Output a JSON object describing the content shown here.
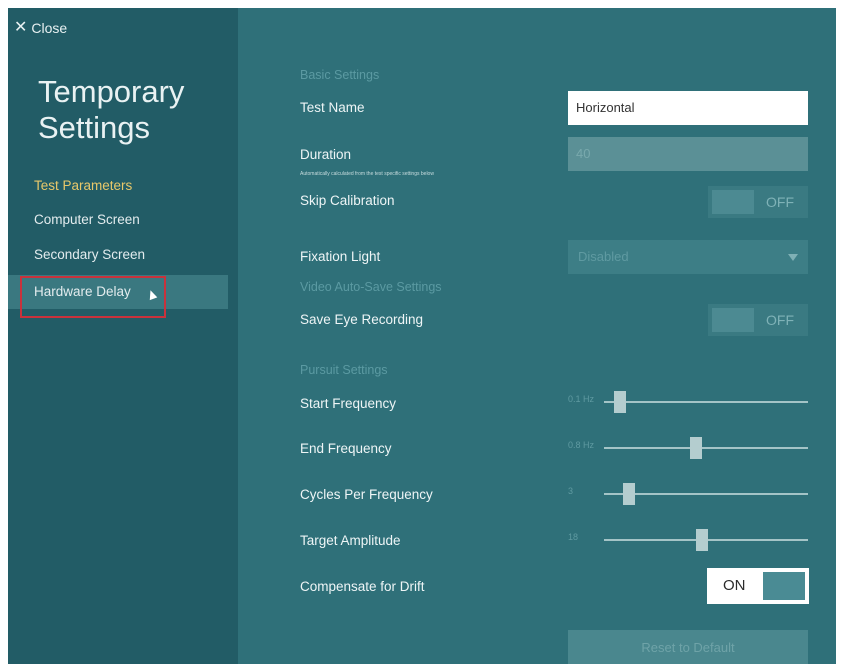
{
  "sidebar": {
    "close_label": "Close",
    "title_line1": "Temporary",
    "title_line2": "Settings",
    "items": [
      {
        "label": "Test Parameters"
      },
      {
        "label": "Computer Screen"
      },
      {
        "label": "Secondary Screen"
      },
      {
        "label": "Hardware Delay"
      }
    ]
  },
  "basic": {
    "section": "Basic Settings",
    "test_name_label": "Test Name",
    "test_name_value": "Horizontal",
    "duration_label": "Duration",
    "duration_note": "Automatically calculated from the test specific settings below",
    "duration_value": "40",
    "skip_calibration_label": "Skip Calibration",
    "skip_calibration_state": "OFF",
    "fixation_light_label": "Fixation Light",
    "fixation_light_value": "Disabled"
  },
  "video": {
    "section": "Video Auto-Save Settings",
    "save_eye_label": "Save Eye Recording",
    "save_eye_state": "OFF"
  },
  "pursuit": {
    "section": "Pursuit Settings",
    "sliders": [
      {
        "label": "Start Frequency",
        "value": "0.1 Hz",
        "fraction": 0.05
      },
      {
        "label": "End Frequency",
        "value": "0.8 Hz",
        "fraction": 0.45
      },
      {
        "label": "Cycles Per Frequency",
        "value": "3",
        "fraction": 0.1
      },
      {
        "label": "Target Amplitude",
        "value": "18",
        "fraction": 0.48
      }
    ],
    "compensate_label": "Compensate for Drift",
    "compensate_state": "ON"
  },
  "reset_label": "Reset to Default",
  "colors": {
    "sidebar_bg": "#225c66",
    "main_bg": "#2f7079",
    "active_nav": "#e8c86a",
    "highlight_border": "#c9323c"
  }
}
